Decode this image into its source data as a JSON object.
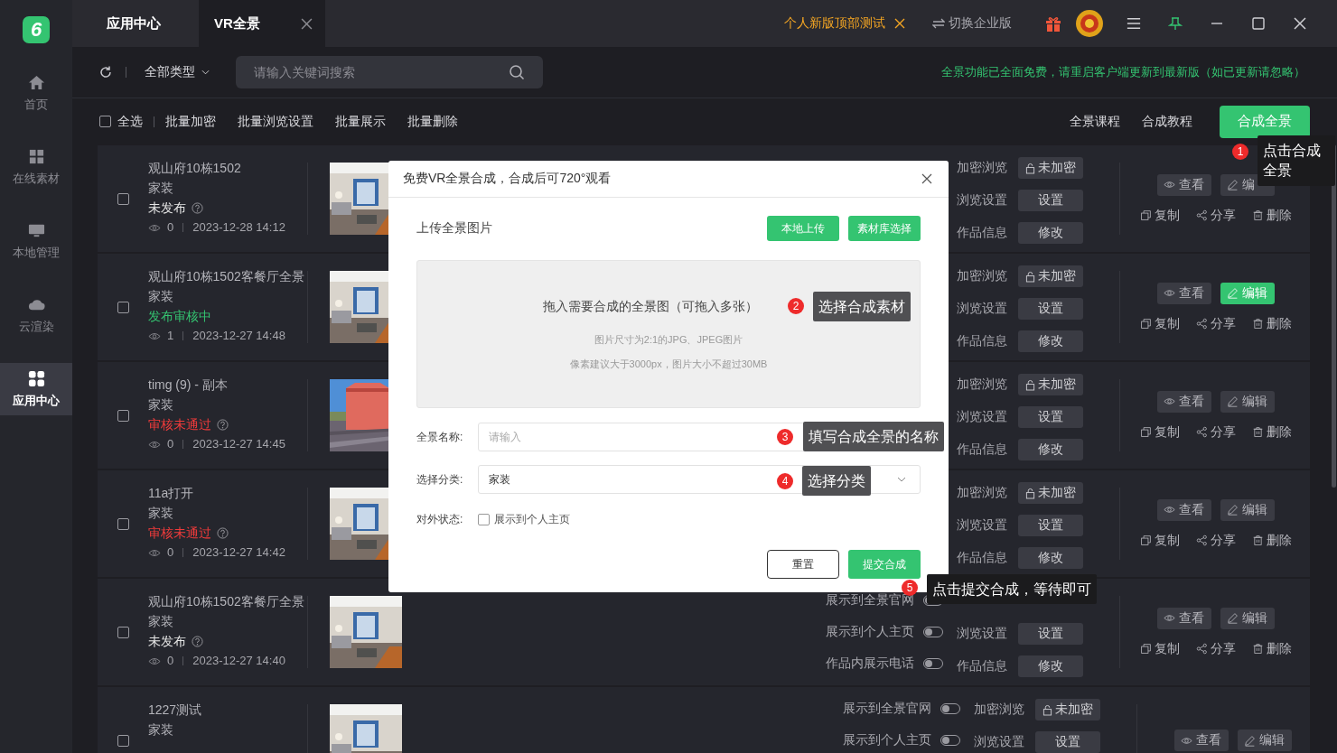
{
  "app": {
    "logo": "6"
  },
  "sidebar": {
    "items": [
      {
        "label": "首页",
        "kind": "home",
        "selected": false
      },
      {
        "label": "在线素材",
        "kind": "grid",
        "selected": false
      },
      {
        "label": "本地管理",
        "kind": "monitor",
        "selected": false
      },
      {
        "label": "云渲染",
        "kind": "cloud",
        "selected": false
      },
      {
        "label": "应用中心",
        "kind": "apps",
        "selected": true
      }
    ]
  },
  "tabs": [
    {
      "label": "应用中心",
      "selected": false,
      "closable": false
    },
    {
      "label": "VR全景",
      "selected": true,
      "closable": true
    }
  ],
  "title_bar": {
    "notice": "个人新版顶部测试",
    "switch_label": "切换企业版"
  },
  "toolbar": {
    "type_filter": "全部类型",
    "search_placeholder": "请输入关键词搜索",
    "notice": "全景功能已全面免费，请重启客户端更新到最新版（如已更新请忽略）"
  },
  "batch_bar": {
    "select_all": {
      "label": "全选",
      "checked": false
    },
    "actions": [
      "批量加密",
      "批量浏览设置",
      "批量展示",
      "批量删除"
    ],
    "links": [
      "全景课程",
      "合成教程"
    ],
    "primary": "合成全景"
  },
  "rows": [
    {
      "title": "观山府10栋1502",
      "category": "家装",
      "status": {
        "text": "未发布",
        "color": "#e6e6e6"
      },
      "help": true,
      "views": "0",
      "date": "2023-12-28 14:12",
      "checked": false,
      "settings": [
        {
          "label": "加密浏览",
          "button": "未加密",
          "kind": "lock"
        },
        {
          "label": "浏览设置",
          "button": "设置",
          "kind": "plain"
        },
        {
          "label": "作品信息",
          "button": "修改",
          "kind": "plain"
        }
      ],
      "actions": [
        {
          "label": "查看",
          "kind": "view",
          "selected": false
        },
        {
          "label": "编",
          "kind": "edit",
          "selected": false
        }
      ],
      "more_actions": [
        {
          "label": "复制",
          "kind": "copy"
        },
        {
          "label": "分享",
          "kind": "share"
        },
        {
          "label": "删除",
          "kind": "delete"
        }
      ]
    },
    {
      "title": "观山府10栋1502客餐厅全景",
      "category": "家装",
      "status": {
        "text": "发布审核中",
        "color": "#34c471"
      },
      "help": false,
      "views": "1",
      "date": "2023-12-27 14:48",
      "checked": false,
      "settings": [
        {
          "label": "加密浏览",
          "button": "未加密",
          "kind": "lock"
        },
        {
          "label": "浏览设置",
          "button": "设置",
          "kind": "plain"
        },
        {
          "label": "作品信息",
          "button": "修改",
          "kind": "plain"
        }
      ],
      "actions": [
        {
          "label": "查看",
          "kind": "view",
          "selected": false
        },
        {
          "label": "编辑",
          "kind": "edit",
          "selected": true
        }
      ],
      "more_actions": [
        {
          "label": "复制",
          "kind": "copy"
        },
        {
          "label": "分享",
          "kind": "share"
        },
        {
          "label": "删除",
          "kind": "delete"
        }
      ]
    },
    {
      "title": "timg (9) - 副本",
      "category": "家装",
      "status": {
        "text": "审核未通过",
        "color": "#f23b3b"
      },
      "help": true,
      "views": "0",
      "date": "2023-12-27 14:45",
      "checked": false,
      "settings": [
        {
          "label": "加密浏览",
          "button": "未加密",
          "kind": "lock"
        },
        {
          "label": "浏览设置",
          "button": "设置",
          "kind": "plain"
        },
        {
          "label": "作品信息",
          "button": "修改",
          "kind": "plain"
        }
      ],
      "actions": [
        {
          "label": "查看",
          "kind": "view",
          "selected": false
        },
        {
          "label": "编辑",
          "kind": "edit",
          "selected": false
        }
      ],
      "more_actions": [
        {
          "label": "复制",
          "kind": "copy"
        },
        {
          "label": "分享",
          "kind": "share"
        },
        {
          "label": "删除",
          "kind": "delete"
        }
      ]
    },
    {
      "title": "11a打开",
      "category": "家装",
      "status": {
        "text": "审核未通过",
        "color": "#f23b3b"
      },
      "help": true,
      "views": "0",
      "date": "2023-12-27 14:42",
      "checked": false,
      "settings": [
        {
          "label": "加密浏览",
          "button": "未加密",
          "kind": "lock"
        },
        {
          "label": "浏览设置",
          "button": "设置",
          "kind": "plain"
        },
        {
          "label": "作品信息",
          "button": "修改",
          "kind": "plain"
        }
      ],
      "actions": [
        {
          "label": "查看",
          "kind": "view",
          "selected": false
        },
        {
          "label": "编辑",
          "kind": "edit",
          "selected": false
        }
      ],
      "more_actions": [
        {
          "label": "复制",
          "kind": "copy"
        },
        {
          "label": "分享",
          "kind": "share"
        },
        {
          "label": "删除",
          "kind": "delete"
        }
      ]
    },
    {
      "title": "观山府10栋1502客餐厅全景",
      "category": "家装",
      "status": {
        "text": "未发布",
        "color": "#e6e6e6"
      },
      "help": true,
      "views": "0",
      "date": "2023-12-27 14:40",
      "checked": false,
      "toggles": [
        {
          "label": "展示到全景官网",
          "on": false
        },
        {
          "label": "展示到个人主页",
          "on": false
        },
        {
          "label": "作品内展示电话",
          "on": false
        }
      ],
      "settings": [
        {
          "label": "浏览设置",
          "button": "设置",
          "kind": "plain"
        },
        {
          "label": "作品信息",
          "button": "修改",
          "kind": "plain"
        }
      ],
      "actions": [
        {
          "label": "查看",
          "kind": "view",
          "selected": false
        },
        {
          "label": "编辑",
          "kind": "edit",
          "selected": false
        }
      ],
      "more_actions": [
        {
          "label": "复制",
          "kind": "copy"
        },
        {
          "label": "分享",
          "kind": "share"
        },
        {
          "label": "删除",
          "kind": "delete"
        }
      ]
    },
    {
      "title": "1227测试",
      "category": "家装",
      "checked": false,
      "toggles": [
        {
          "label": "展示到全景官网",
          "on": false
        },
        {
          "label": "展示到个人主页",
          "on": false
        }
      ],
      "settings": [
        {
          "label": "加密浏览",
          "button": "未加密",
          "kind": "lock"
        },
        {
          "label": "浏览设置",
          "button": "设置",
          "kind": "plain"
        }
      ],
      "actions": [
        {
          "label": "查看",
          "kind": "view",
          "selected": false
        },
        {
          "label": "编辑",
          "kind": "edit",
          "selected": false
        }
      ]
    }
  ],
  "dialog": {
    "title": "免费VR全景合成，合成后可720°观看",
    "upload_label": "上传全景图片",
    "upload_buttons": [
      "本地上传",
      "素材库选择"
    ],
    "drop_title": "拖入需要合成的全景图（可拖入多张）",
    "drop_hints": [
      "图片尺寸为2:1的JPG、JPEG图片",
      "像素建议大于3000px，图片大小不超过30MB"
    ],
    "fields": [
      {
        "label": "全景名称:",
        "kind": "text",
        "placeholder": "请输入"
      },
      {
        "label": "选择分类:",
        "kind": "select",
        "value": "家装"
      },
      {
        "label": "对外状态:",
        "kind": "checkbox",
        "option": "展示到个人主页",
        "checked": false
      }
    ],
    "buttons": [
      {
        "label": "重置",
        "kind": "secondary"
      },
      {
        "label": "提交合成",
        "kind": "primary"
      }
    ]
  },
  "callouts": [
    {
      "number": "1",
      "text": "点击合成全景"
    },
    {
      "number": "2",
      "text": "选择合成素材"
    },
    {
      "number": "3",
      "text": "填写合成全景的名称"
    },
    {
      "number": "4",
      "text": "选择分类"
    },
    {
      "number": "5",
      "text": "点击提交合成，等待即可"
    }
  ]
}
